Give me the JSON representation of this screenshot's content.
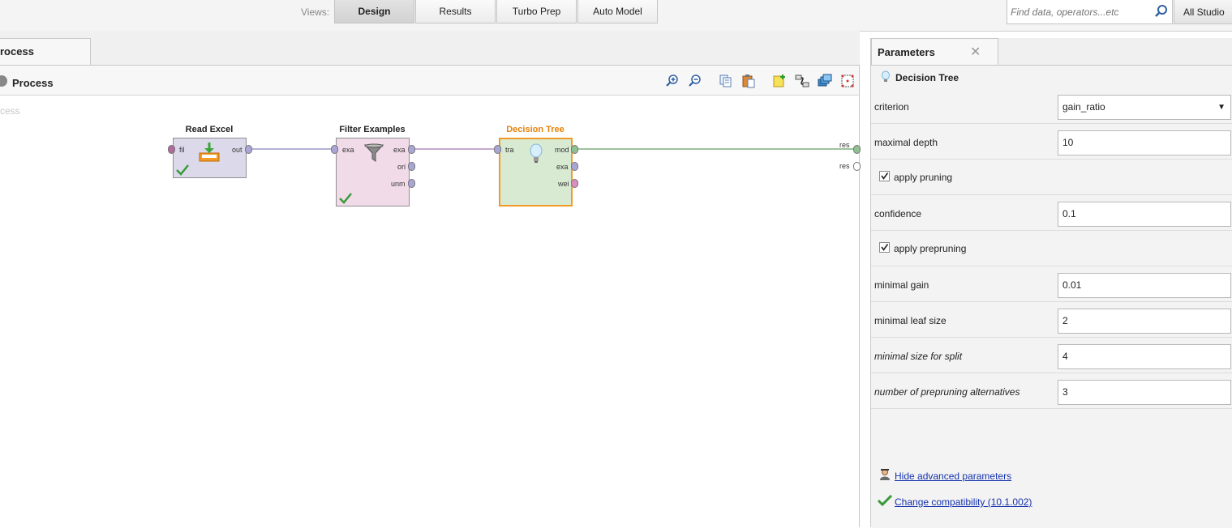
{
  "topbar": {
    "views_label": "Views:",
    "tabs": [
      {
        "label": "Design",
        "active": true
      },
      {
        "label": "Results",
        "active": false
      },
      {
        "label": "Turbo Prep",
        "active": false
      },
      {
        "label": "Auto Model",
        "active": false
      }
    ],
    "search_placeholder": "Find data, operators...etc",
    "studio_label": "All Studio"
  },
  "process_panel": {
    "tab_label": "rocess",
    "header_title": "Process",
    "canvas_label": "cess",
    "toolbar_icons": [
      "zoom-in-icon",
      "zoom-out-icon",
      "copy-icon",
      "paste-icon",
      "add-note-icon",
      "auto-wire-icon",
      "layers-icon",
      "fit-view-icon"
    ],
    "operators": {
      "read_excel": {
        "title": "Read Excel",
        "ports_in": [
          "fil"
        ],
        "ports_out": [
          "out"
        ],
        "status": "ok"
      },
      "filter_examples": {
        "title": "Filter Examples",
        "ports_in": [
          "exa"
        ],
        "ports_out": [
          "exa",
          "ori",
          "unm"
        ],
        "status": "ok"
      },
      "decision_tree": {
        "title": "Decision Tree",
        "ports_in": [
          "tra"
        ],
        "ports_out": [
          "mod",
          "exa",
          "wei"
        ],
        "status": "selected"
      }
    },
    "result_ports": [
      "res",
      "res"
    ],
    "colors": {
      "read_excel_fill": "#dcdaea",
      "filter_fill": "#f1dbe8",
      "tree_fill": "#d9ead3",
      "tree_border": "#f29a26",
      "tree_title": "#e6820a",
      "connection": "#7f9fb7",
      "model_connection": "#7fae7f"
    }
  },
  "parameters": {
    "tab_label": "Parameters",
    "operator_name": "Decision Tree",
    "rows": [
      {
        "label": "criterion",
        "type": "select",
        "value": "gain_ratio",
        "italic": false
      },
      {
        "label": "maximal depth",
        "type": "text",
        "value": "10",
        "italic": false
      },
      {
        "label": "apply pruning",
        "type": "checkbox",
        "checked": true,
        "italic": false
      },
      {
        "label": "confidence",
        "type": "text",
        "value": "0.1",
        "italic": false
      },
      {
        "label": "apply prepruning",
        "type": "checkbox",
        "checked": true,
        "italic": false
      },
      {
        "label": "minimal gain",
        "type": "text",
        "value": "0.01",
        "italic": false
      },
      {
        "label": "minimal leaf size",
        "type": "text",
        "value": "2",
        "italic": false
      },
      {
        "label": "minimal size for split",
        "type": "text",
        "value": "4",
        "italic": true
      },
      {
        "label": "number of prepruning alternatives",
        "type": "text",
        "value": "3",
        "italic": true
      }
    ],
    "hide_advanced_label": "Hide advanced parameters",
    "compatibility_label": "Change compatibility (10.1.002)"
  }
}
